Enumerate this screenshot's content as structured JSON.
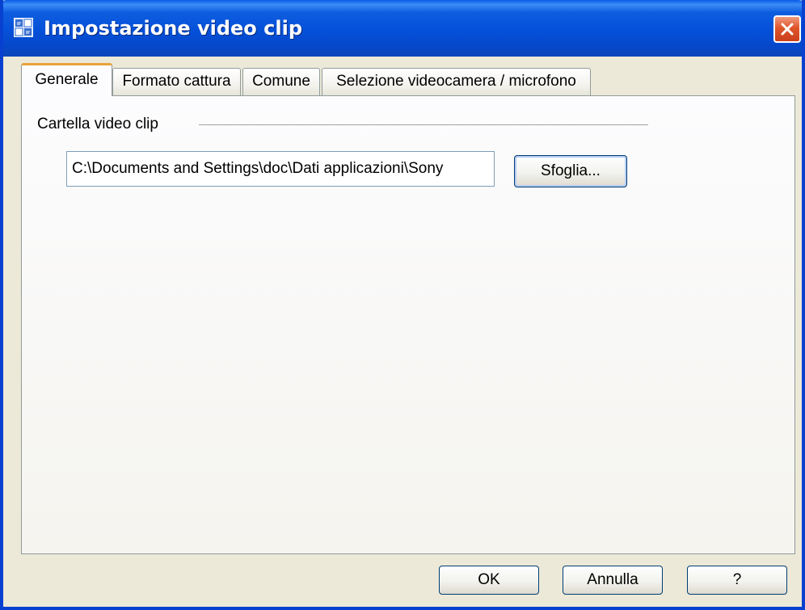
{
  "window": {
    "title": "Impostazione video clip",
    "icon": "video-clip-app-icon",
    "close_icon": "close-x-icon",
    "accent_color": "#0550d8"
  },
  "tabs": [
    {
      "label": "Generale",
      "active": true
    },
    {
      "label": "Formato cattura",
      "active": false
    },
    {
      "label": "Comune",
      "active": false
    },
    {
      "label": "Selezione videocamera / microfono",
      "active": false
    }
  ],
  "general": {
    "group_label": "Cartella video clip",
    "folder_path": "C:\\Documents and Settings\\doc\\Dati applicazioni\\Sony",
    "browse_label": "Sfoglia..."
  },
  "footer": {
    "ok_label": "OK",
    "cancel_label": "Annulla",
    "help_label": "?"
  }
}
